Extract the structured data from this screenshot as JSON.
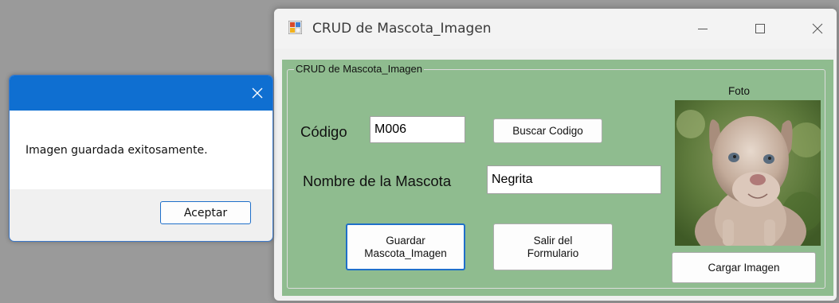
{
  "window": {
    "title": "CRUD de Mascota_Imagen"
  },
  "form": {
    "group_label": "CRUD de Mascota_Imagen",
    "codigo_label": "Código",
    "codigo_value": "M006",
    "buscar_button": "Buscar Codigo",
    "nombre_label": "Nombre de la Mascota",
    "nombre_value": "Negrita",
    "guardar_button_line1": "Guardar",
    "guardar_button_line2": "Mascota_Imagen",
    "salir_button_line1": "Salir del",
    "salir_button_line2": "Formulario",
    "foto_label": "Foto",
    "cargar_button": "Cargar Imagen"
  },
  "message_box": {
    "text": "Imagen guardada exitosamente.",
    "ok_button": "Aceptar"
  },
  "icons": {
    "app": "form-app-icon",
    "minimize": "minimize-icon",
    "maximize": "maximize-icon",
    "close": "close-icon"
  },
  "colors": {
    "form_background": "#8fbc8f",
    "message_titlebar": "#0f6fd1",
    "focus_border": "#1f6fc9"
  }
}
